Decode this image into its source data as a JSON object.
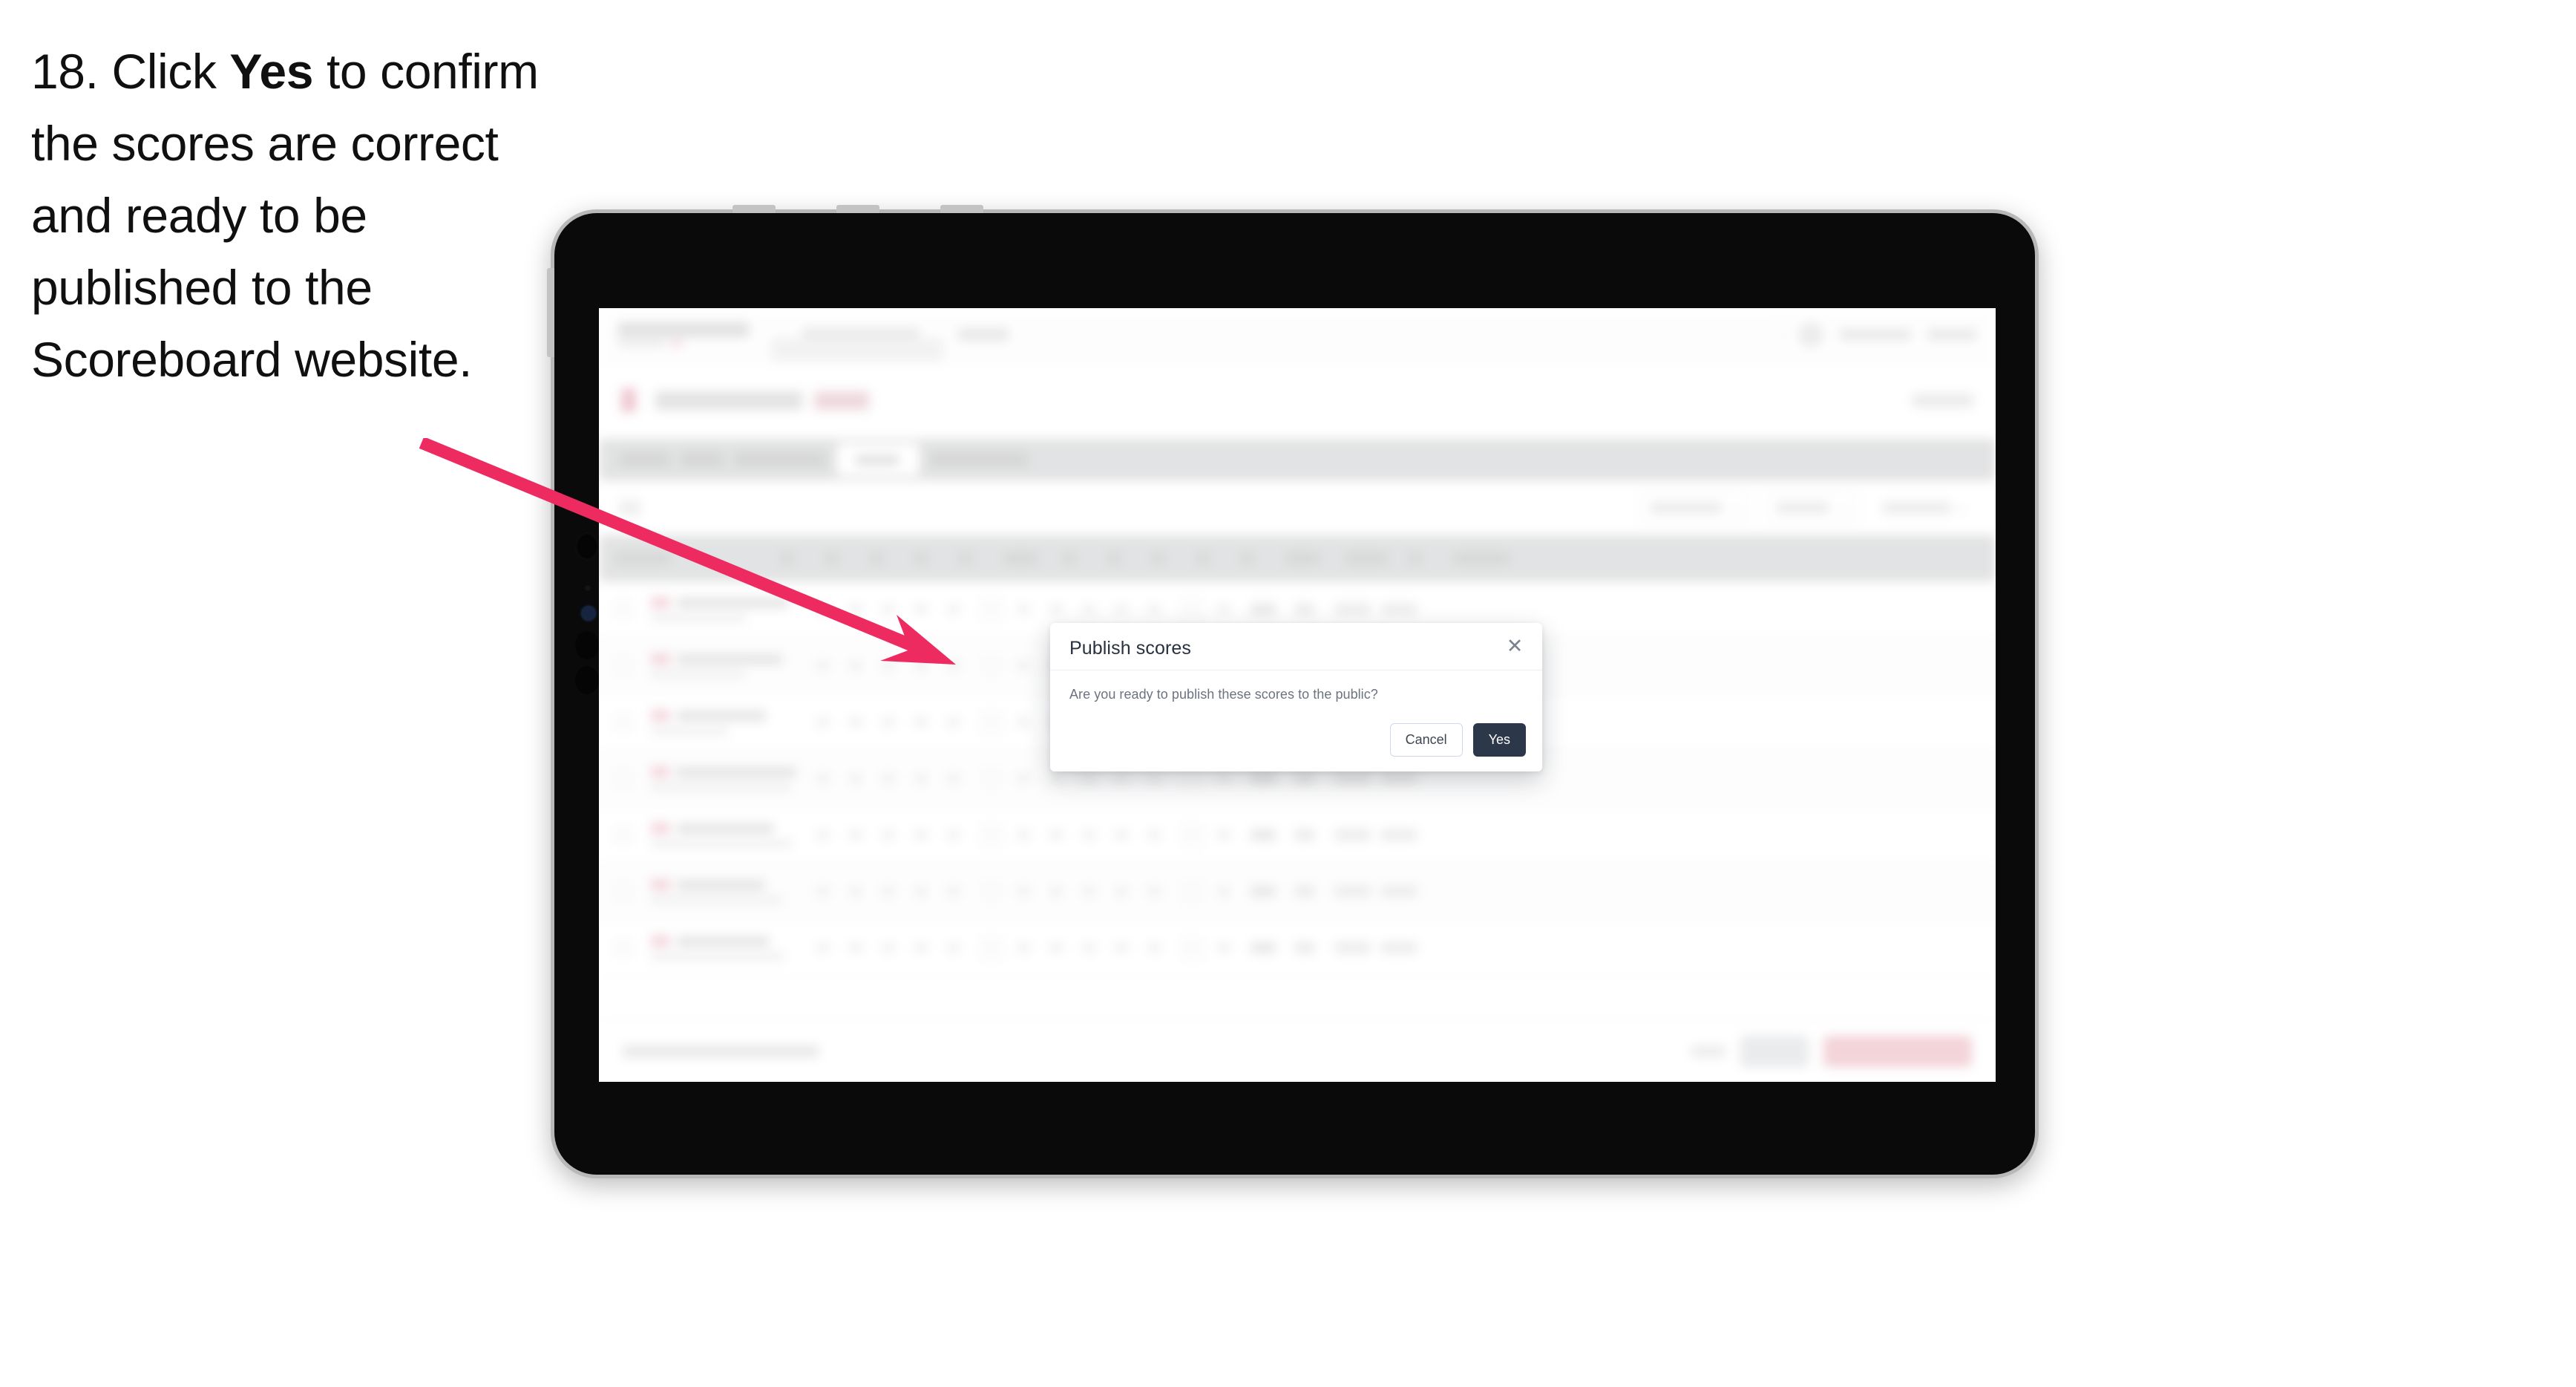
{
  "caption": {
    "prefix": "18. Click ",
    "bold": "Yes",
    "suffix": " to confirm the scores are correct and ready to be published to the Scoreboard website."
  },
  "colors": {
    "arrow": "#ED2B61",
    "yes_button_bg": "#2C3749",
    "cancel_border": "#CFD9EA",
    "device_bezel": "#0A0A0A",
    "device_edge": "#B8B8B8",
    "publish_button": "#F9B9C6"
  },
  "modal": {
    "title": "Publish scores",
    "message": "Are you ready to publish these scores to the public?",
    "close_icon": "✕",
    "cancel_label": "Cancel",
    "confirm_label": "Yes"
  },
  "app": {
    "rows_count": 7,
    "score_columns": 13
  }
}
